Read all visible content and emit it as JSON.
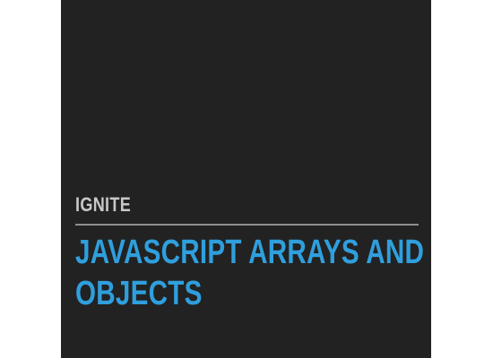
{
  "slide": {
    "kicker": "IGNITE",
    "title_lines": [
      "JAVASCRIPT ARRAYS AND",
      "OBJECTS"
    ],
    "colors": {
      "page_background": "#ffffff",
      "slide_background": "#222222",
      "kicker_text": "#c8c8c8",
      "divider": "#8f8f8f",
      "title_text": "#2f9fdd"
    }
  }
}
